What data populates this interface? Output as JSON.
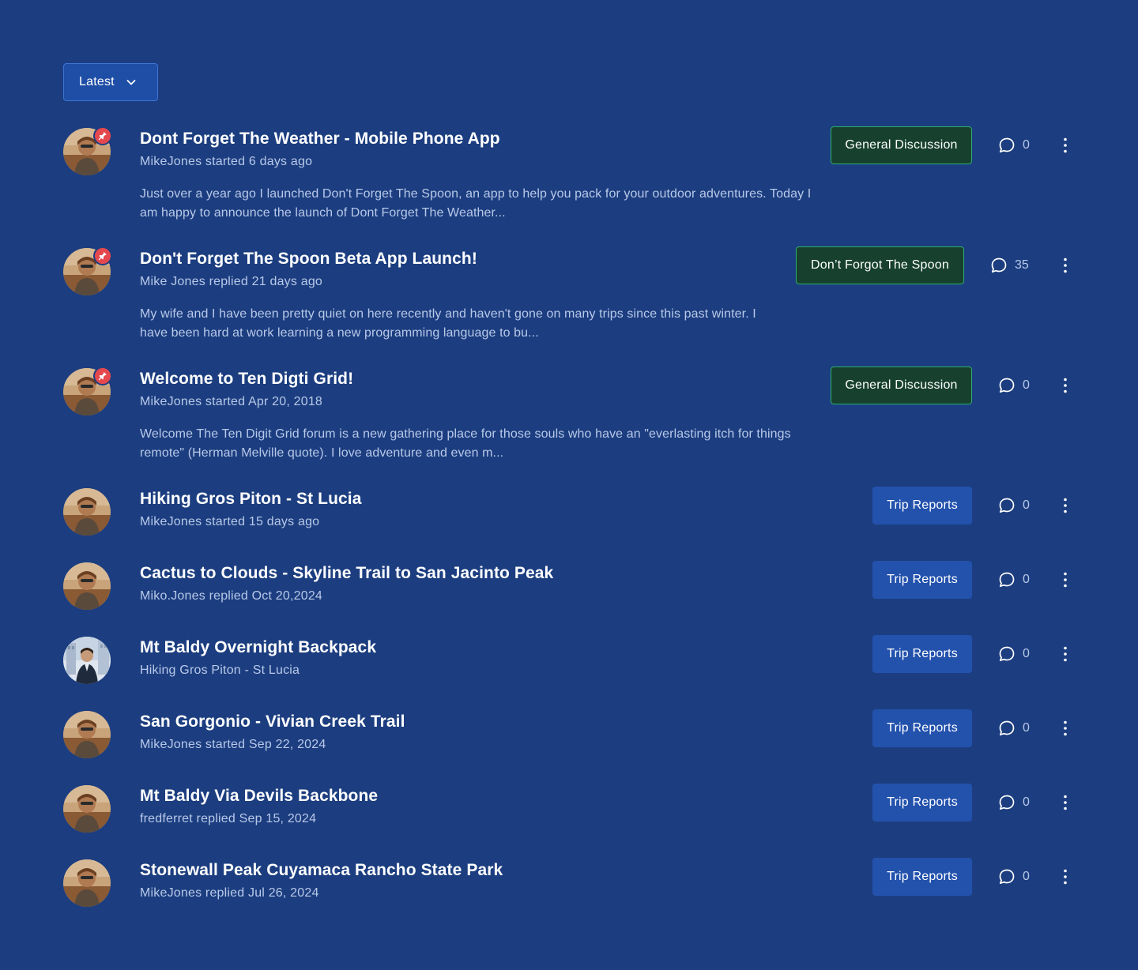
{
  "sort": {
    "label": "Latest",
    "icon": "chevron-down-icon"
  },
  "colors": {
    "background": "#1c3e80",
    "green_tag_bg": "#17402f",
    "green_tag_border": "#2fae6a",
    "blue_tag_bg": "#2352ad",
    "pin_badge": "#e5484d"
  },
  "topics": [
    {
      "title": "Dont Forget The Weather - Mobile Phone App",
      "meta": "MikeJones started 6 days ago",
      "excerpt": "Just over a year ago I launched Don't Forget The Spoon, an app to help you pack for your outdoor adventures. Today I am happy to announce the launch of Dont Forget The Weather...",
      "category": "General Discussion",
      "replies": "0",
      "pinned": true
    },
    {
      "title": "Don't Forget The Spoon Beta App Launch!",
      "meta": "Mike Jones replied 21 days ago",
      "excerpt": "My wife and I have been pretty quiet on here recently and haven't gone on many trips since this past winter. I have been hard at work learning a new programming language to bu...",
      "category": "Don’t Forgot The Spoon",
      "replies": "35",
      "pinned": true
    },
    {
      "title": "Welcome to Ten Digti Grid!",
      "meta": "MikeJones started Apr 20, 2018",
      "excerpt": "Welcome The Ten Digit Grid forum is a new gathering place for those souls who have an \"everlasting itch for things remote\" (Herman Melville quote). I love adventure and even m...",
      "category": "General Discussion",
      "replies": "0",
      "pinned": true
    },
    {
      "title": "Hiking Gros Piton - St Lucia",
      "meta": "MikeJones started 15 days ago",
      "category": "Trip Reports",
      "replies": "0",
      "pinned": false
    },
    {
      "title": "Cactus to Clouds - Skyline Trail to San Jacinto Peak",
      "meta": "Miko.Jones replied Oct 20,2024",
      "category": "Trip Reports",
      "replies": "0",
      "pinned": false
    },
    {
      "title": "Mt Baldy Overnight Backpack",
      "meta": "Hiking Gros Piton - St Lucia",
      "category": "Trip Reports",
      "replies": "0",
      "pinned": false
    },
    {
      "title": "San Gorgonio - Vivian Creek Trail",
      "meta": "MikeJones started Sep 22, 2024",
      "category": "Trip Reports",
      "replies": "0",
      "pinned": false
    },
    {
      "title": "Mt Baldy Via Devils Backbone",
      "meta": "fredferret replied Sep 15, 2024",
      "category": "Trip Reports",
      "replies": "0",
      "pinned": false
    },
    {
      "title": "Stonewall Peak Cuyamaca Rancho State Park",
      "meta": "MikeJones replied Jul 26, 2024",
      "category": "Trip Reports",
      "replies": "0",
      "pinned": false
    }
  ]
}
